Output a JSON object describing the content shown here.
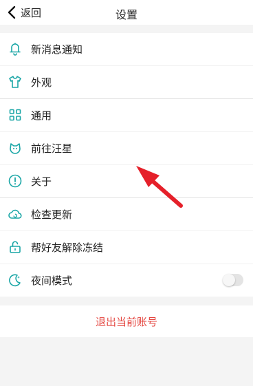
{
  "header": {
    "back_label": "返回",
    "title": "设置"
  },
  "menu": [
    {
      "label": "新消息通知",
      "icon": "bell-icon"
    },
    {
      "label": "外观",
      "icon": "tshirt-icon"
    },
    {
      "label": "通用",
      "icon": "grid-icon"
    },
    {
      "label": "前往汪星",
      "icon": "dog-face-icon"
    },
    {
      "label": "关于",
      "icon": "info-circle-icon"
    },
    {
      "label": "检查更新",
      "icon": "cloud-refresh-icon"
    },
    {
      "label": "帮好友解除冻结",
      "icon": "unlock-icon"
    },
    {
      "label": "夜间模式",
      "icon": "moon-icon",
      "toggle_on": false
    }
  ],
  "logout_label": "退出当前账号",
  "colors": {
    "icon_teal": "#1aa6a6",
    "logout_red": "#e4453f",
    "annotation_red": "#e5202a",
    "background": "#f4f4f4"
  }
}
